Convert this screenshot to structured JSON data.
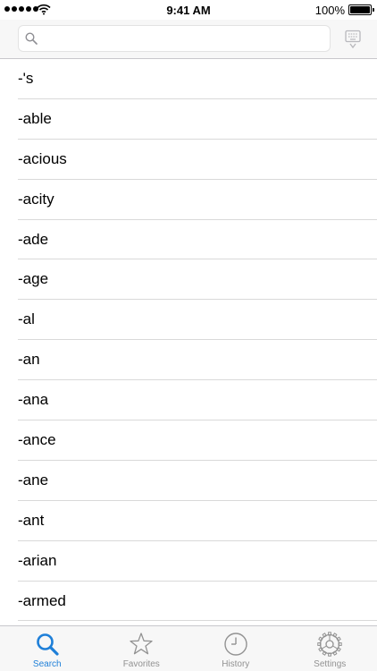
{
  "status_bar": {
    "time": "9:41 AM",
    "battery_percent": "100%",
    "signal_bars": 5,
    "battery_level": 1.0
  },
  "search": {
    "placeholder": "",
    "value": ""
  },
  "words": [
    "-'s",
    "-able",
    "-acious",
    "-acity",
    "-ade",
    "-age",
    "-al",
    "-an",
    "-ana",
    "-ance",
    "-ane",
    "-ant",
    "-arian",
    "-armed"
  ],
  "tabs": [
    {
      "label": "Search",
      "icon": "search-icon",
      "active": true
    },
    {
      "label": "Favorites",
      "icon": "star-icon",
      "active": false
    },
    {
      "label": "History",
      "icon": "clock-icon",
      "active": false
    },
    {
      "label": "Settings",
      "icon": "gear-icon",
      "active": false
    }
  ],
  "colors": {
    "accent": "#1e7fd8",
    "inactive": "#929292"
  }
}
